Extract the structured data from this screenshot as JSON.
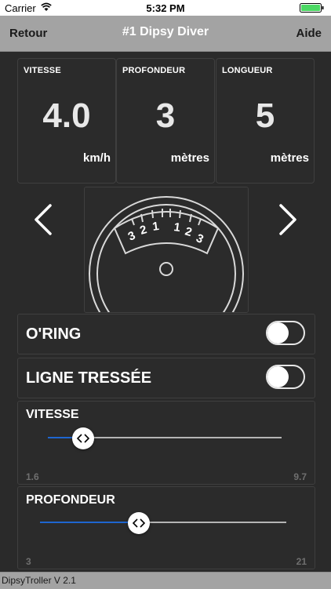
{
  "status_bar": {
    "carrier": "Carrier",
    "time": "5:32 PM"
  },
  "nav": {
    "back_label": "Retour",
    "title": "#1 Dipsy Diver",
    "help_label": "Aide"
  },
  "stats": [
    {
      "label": "VITESSE",
      "value": "4.0",
      "unit": "km/h"
    },
    {
      "label": "PROFONDEUR",
      "value": "3",
      "unit": "mètres"
    },
    {
      "label": "LONGUEUR",
      "value": "5",
      "unit": "mètres"
    }
  ],
  "gauge": {
    "left_scale": [
      "3",
      "2",
      "1"
    ],
    "right_scale": [
      "1",
      "2",
      "3"
    ]
  },
  "toggles": [
    {
      "label": "O'RING",
      "on": false
    },
    {
      "label": "LIGNE TRESSÉE",
      "on": false
    }
  ],
  "sliders": [
    {
      "label": "VITESSE",
      "min": "1.6",
      "max": "9.7",
      "position_fraction": 0.15
    },
    {
      "label": "PROFONDEUR",
      "min": "3",
      "max": "21",
      "position_fraction": 0.4
    }
  ],
  "footer": {
    "version": "DipsyTroller V 2.1"
  },
  "colors": {
    "nav_bg": "#a3a3a3",
    "body_bg": "#2a2a2a",
    "accent": "#1e66d0",
    "battery": "#4cd964"
  }
}
